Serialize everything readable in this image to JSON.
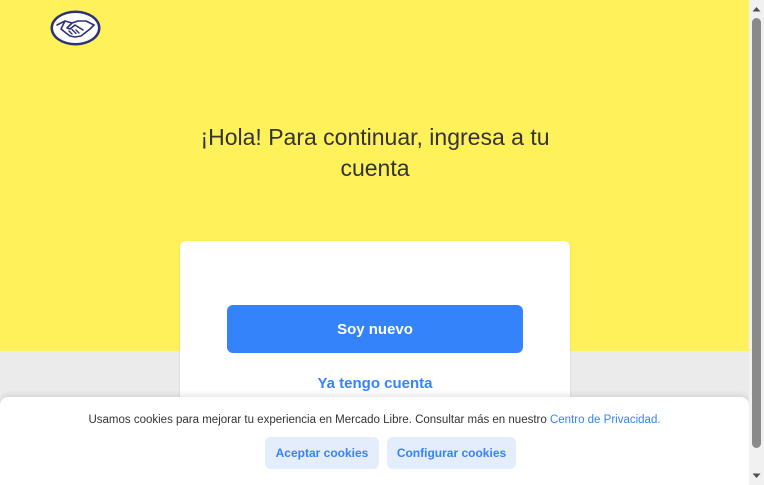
{
  "header": {
    "logo_icon": "handshake-logo-icon"
  },
  "main": {
    "heading": "¡Hola! Para continuar, ingresa a tu cuenta",
    "new_user_button": "Soy nuevo",
    "existing_account_link": "Ya tengo cuenta"
  },
  "cookie_banner": {
    "message": "Usamos cookies para mejorar tu experiencia en Mercado Libre. Consultar más en nuestro ",
    "privacy_link": "Centro de Privacidad.",
    "accept_button": "Aceptar cookies",
    "configure_button": "Configurar cookies"
  },
  "colors": {
    "brand_yellow": "#fff159",
    "accent_blue": "#3483fa",
    "secondary_button_bg": "#e3edfb",
    "page_background": "#ebebeb"
  }
}
